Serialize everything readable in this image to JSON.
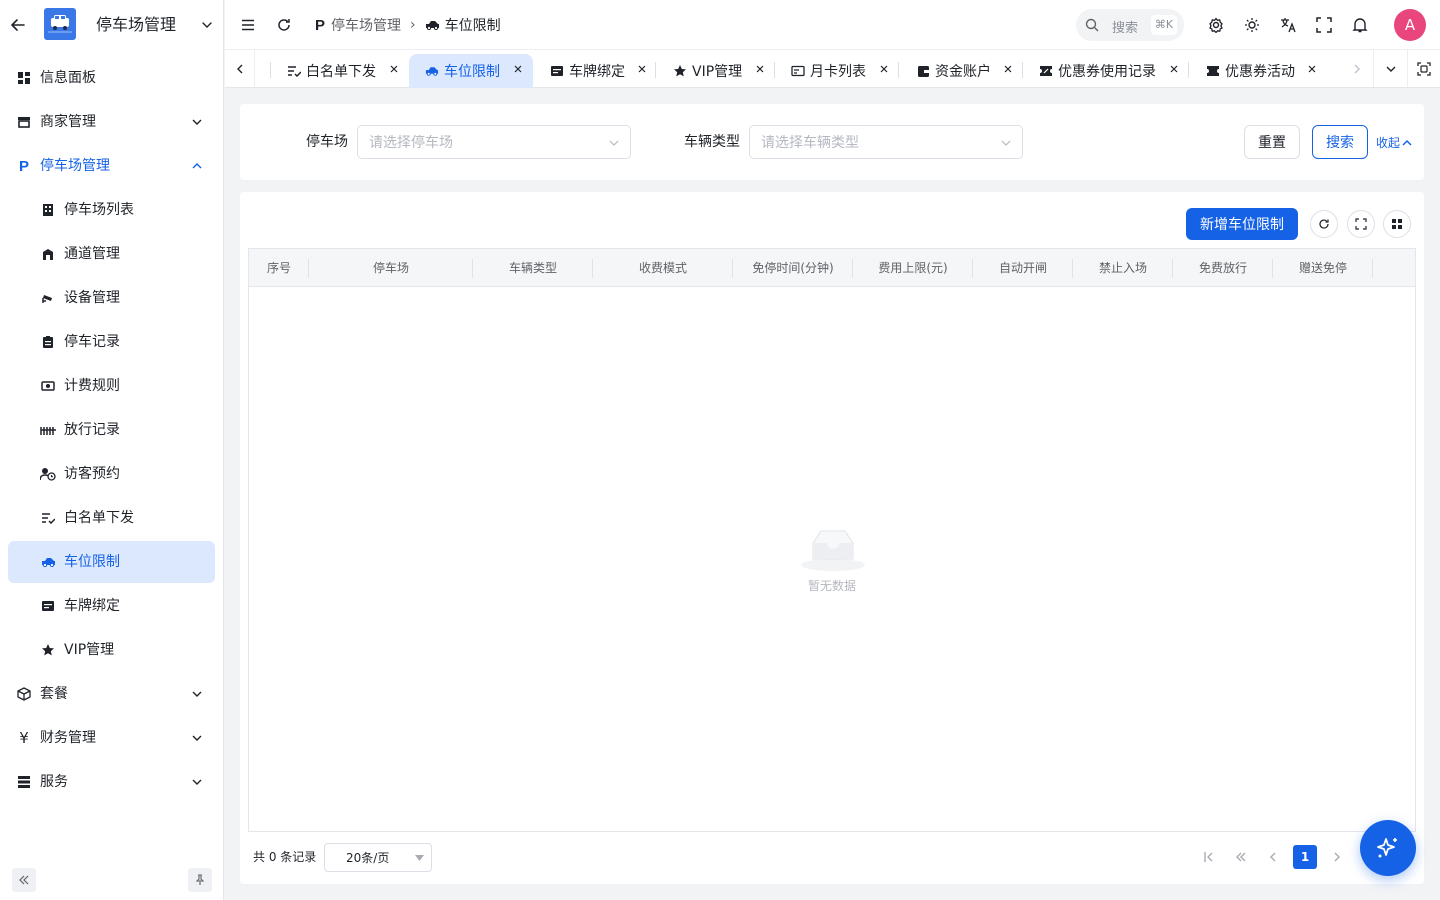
{
  "sidebar": {
    "app_title": "停车场管理",
    "items": [
      {
        "label": "信息面板"
      },
      {
        "label": "商家管理"
      },
      {
        "label": "停车场管理"
      },
      {
        "label": "停车场列表"
      },
      {
        "label": "通道管理"
      },
      {
        "label": "设备管理"
      },
      {
        "label": "停车记录"
      },
      {
        "label": "计费规则"
      },
      {
        "label": "放行记录"
      },
      {
        "label": "访客预约"
      },
      {
        "label": "白名单下发"
      },
      {
        "label": "车位限制"
      },
      {
        "label": "车牌绑定"
      },
      {
        "label": "VIP管理"
      },
      {
        "label": "套餐"
      },
      {
        "label": "财务管理"
      },
      {
        "label": "服务"
      }
    ]
  },
  "header": {
    "breadcrumb": [
      "停车场管理",
      "车位限制"
    ],
    "search_label": "搜索",
    "search_shortcut": "⌘K",
    "avatar": "A"
  },
  "tabs": [
    {
      "label": "白名单下发"
    },
    {
      "label": "车位限制"
    },
    {
      "label": "车牌绑定"
    },
    {
      "label": "VIP管理"
    },
    {
      "label": "月卡列表"
    },
    {
      "label": "资金账户"
    },
    {
      "label": "优惠券使用记录"
    },
    {
      "label": "优惠券活动"
    }
  ],
  "filters": {
    "parking_label": "停车场",
    "parking_placeholder": "请选择停车场",
    "vehicle_type_label": "车辆类型",
    "vehicle_type_placeholder": "请选择车辆类型",
    "reset": "重置",
    "search": "搜索",
    "collapse": "收起"
  },
  "table": {
    "add_button": "新增车位限制",
    "columns": [
      "序号",
      "停车场",
      "车辆类型",
      "收费模式",
      "免停时间(分钟)",
      "费用上限(元)",
      "自动开闸",
      "禁止入场",
      "免费放行",
      "赠送免停"
    ],
    "empty_text": "暂无数据"
  },
  "pagination": {
    "total_text": "共 0 条记录",
    "page_size": "20条/页",
    "current_page": "1"
  },
  "colors": {
    "primary": "#1562e6",
    "active_bg": "#dbe8fd",
    "avatar": "#e8467c"
  }
}
